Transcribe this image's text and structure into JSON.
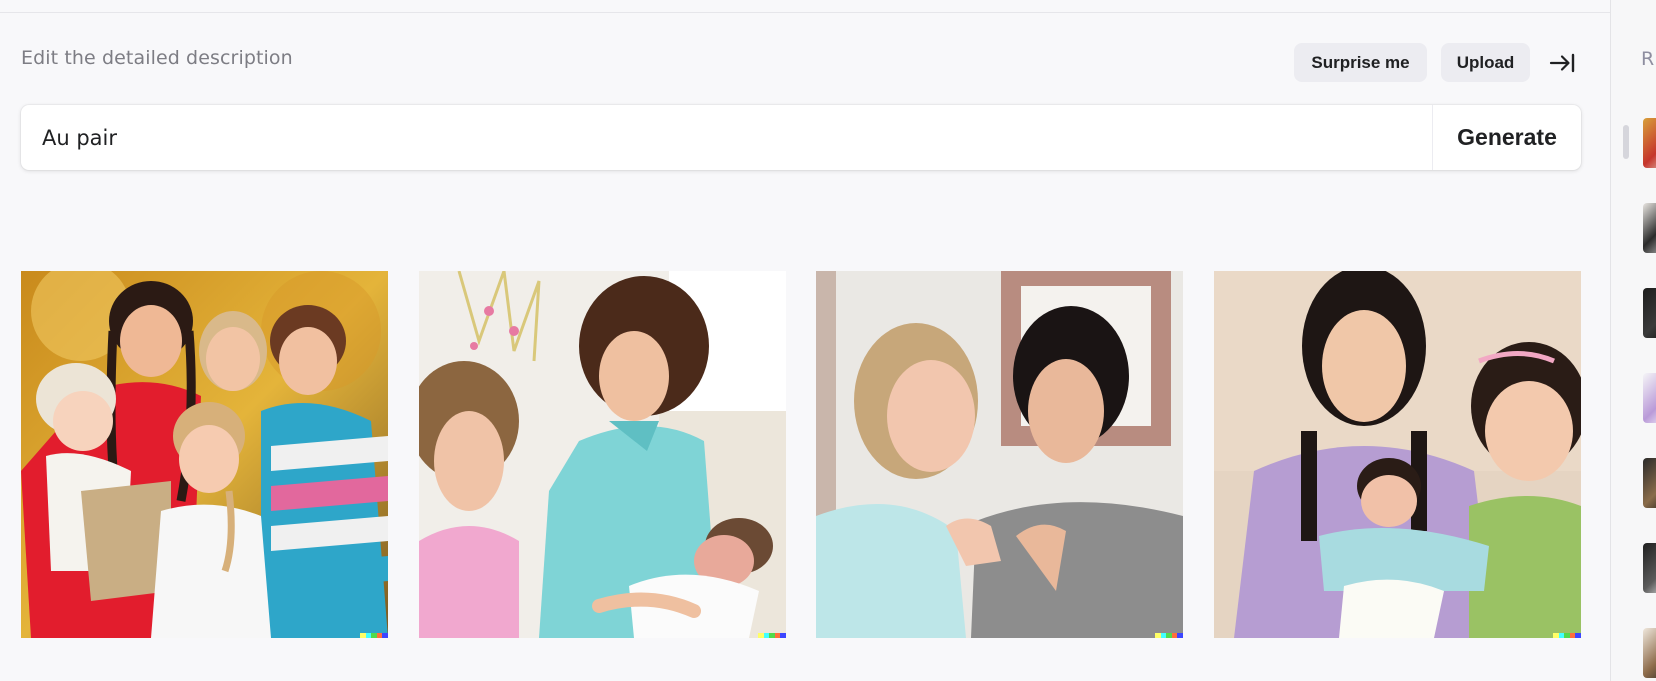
{
  "header": {
    "title": "Edit the detailed description",
    "surprise_label": "Surprise me",
    "upload_label": "Upload"
  },
  "prompt": {
    "value": "Au pair",
    "generate_label": "Generate"
  },
  "results": [
    {
      "name": "Au pair result 1"
    },
    {
      "name": "Au pair result 2"
    },
    {
      "name": "Au pair result 3"
    },
    {
      "name": "Au pair result 4"
    }
  ],
  "history": {
    "label": "R"
  },
  "colors": {
    "background": "#f8f8fa",
    "button_bg": "#ececf1",
    "text": "#202123",
    "muted": "#7d7d84",
    "badge": [
      "#ffff66",
      "#42ffff",
      "#51da4c",
      "#ff6e3c",
      "#3c46ff"
    ]
  },
  "icons": {
    "collapse": "arrow-right-to-bar-icon"
  }
}
